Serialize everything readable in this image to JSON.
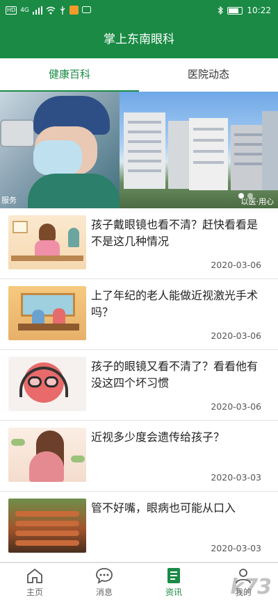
{
  "statusbar": {
    "left_icons": [
      "hd-icon",
      "signal-icon",
      "wifi-icon",
      "usb-icon",
      "app-notification-icon",
      "message-icon"
    ],
    "hd_label": "HD",
    "net_label": "4G",
    "time": "10:22",
    "right_icons": [
      "bluetooth-icon",
      "battery-icon"
    ]
  },
  "appbar": {
    "title": "掌上东南眼科"
  },
  "tabs": [
    {
      "label": "健康百科",
      "active": true
    },
    {
      "label": "医院动态",
      "active": false
    }
  ],
  "banner": {
    "left_caption": "服务",
    "right_caption": "以医·用心",
    "slide_count": 3,
    "active_slide": 1
  },
  "articles": [
    {
      "title": "孩子戴眼镜也看不清？赶快看看是不是这几种情况",
      "date": "2020-03-06"
    },
    {
      "title": "上了年纪的老人能做近视激光手术吗？",
      "date": "2020-03-06"
    },
    {
      "title": "孩子的眼镜又看不清了？看看他有没这四个坏习惯",
      "date": "2020-03-06"
    },
    {
      "title": "近视多少度会遗传给孩子？",
      "date": "2020-03-03"
    },
    {
      "title": "管不好嘴，眼病也可能从口入",
      "date": "2020-03-03"
    }
  ],
  "bottomnav": [
    {
      "label": "主页",
      "icon": "home-icon",
      "active": false
    },
    {
      "label": "消息",
      "icon": "chat-icon",
      "active": false
    },
    {
      "label": "资讯",
      "icon": "news-icon",
      "active": true
    },
    {
      "label": "我的",
      "icon": "profile-icon",
      "active": false
    }
  ],
  "watermark": "k73",
  "colors": {
    "primary": "#1a8a45",
    "text": "#222222",
    "muted": "#555555"
  }
}
